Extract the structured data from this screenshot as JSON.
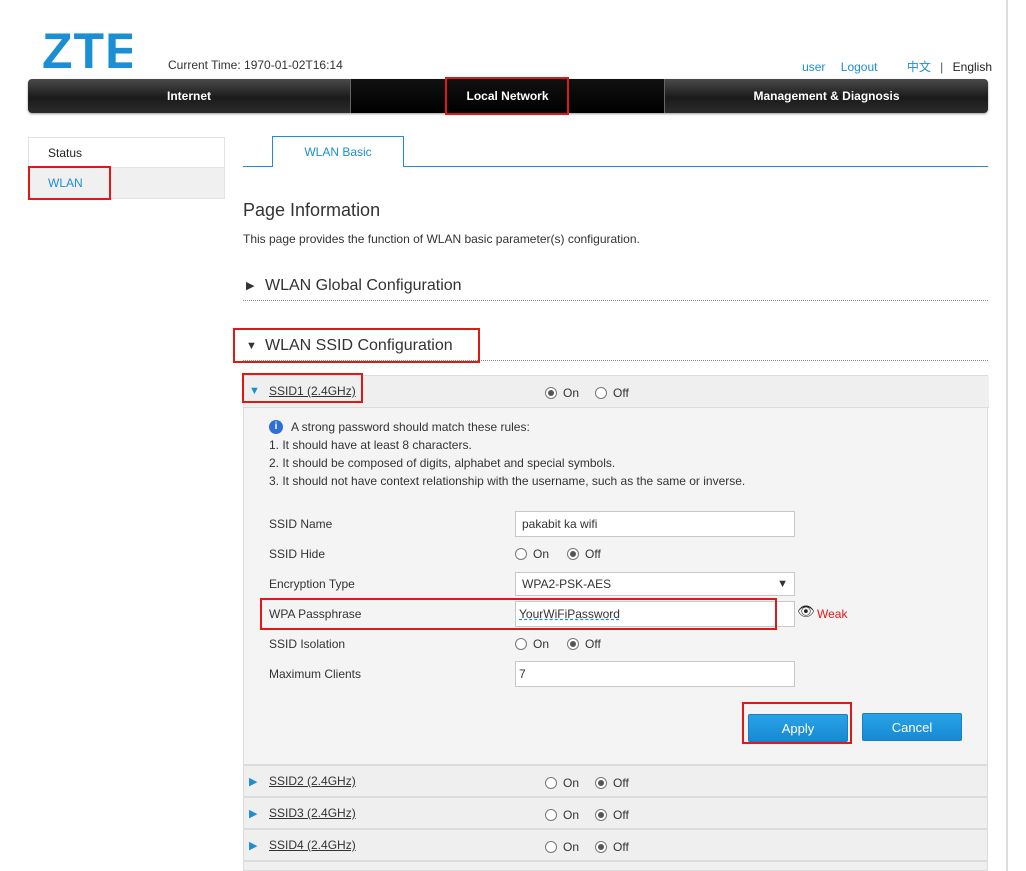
{
  "header": {
    "logo_text": "ZTE",
    "current_time_label": "Current Time: 1970-01-02T16:14",
    "user_link": "user",
    "logout_link": "Logout",
    "lang_zh": "中文",
    "lang_sep": "|",
    "lang_en": "English"
  },
  "nav": {
    "items": [
      {
        "label": "Internet"
      },
      {
        "label": "Local Network"
      },
      {
        "label": "Management & Diagnosis"
      }
    ]
  },
  "sidebar": {
    "items": [
      {
        "label": "Status"
      },
      {
        "label": "WLAN"
      }
    ]
  },
  "tabs": [
    {
      "label": "WLAN Basic"
    }
  ],
  "page": {
    "title": "Page Information",
    "description": "This page provides the function of WLAN basic parameter(s) configuration."
  },
  "sections": {
    "global": {
      "icon": "▶",
      "title": "WLAN Global Configuration"
    },
    "ssid": {
      "icon": "▼",
      "title": "WLAN SSID Configuration"
    }
  },
  "radio_labels": {
    "on": "On",
    "off": "Off"
  },
  "ssid1": {
    "name": "SSID1 (2.4GHz)",
    "state": "On",
    "rules": {
      "info_glyph": "i",
      "intro": "A strong password should match these rules:",
      "r1": "1. It should have at least 8 characters.",
      "r2": "2. It should be composed of digits, alphabet and special symbols.",
      "r3": "3. It should not have context relationship with the username, such as the same or inverse."
    },
    "fields": {
      "ssid_name_label": "SSID Name",
      "ssid_name_value": "pakabit ka wifi",
      "ssid_hide_label": "SSID Hide",
      "ssid_hide_value": "Off",
      "encryption_label": "Encryption Type",
      "encryption_value": "WPA2-PSK-AES",
      "wpa_label": "WPA Passphrase",
      "wpa_value": "YourWiFiPassword",
      "wpa_strength": "Weak",
      "isolation_label": "SSID Isolation",
      "isolation_value": "Off",
      "max_clients_label": "Maximum Clients",
      "max_clients_value": "7"
    },
    "apply_label": "Apply",
    "cancel_label": "Cancel"
  },
  "other_ssids": [
    {
      "name": "SSID2 (2.4GHz)",
      "state": "Off"
    },
    {
      "name": "SSID3 (2.4GHz)",
      "state": "Off"
    },
    {
      "name": "SSID4 (2.4GHz)",
      "state": "Off"
    }
  ],
  "colors": {
    "accent": "#1a8fd4",
    "highlight": "#e21818",
    "nav_dark": "#1a1a1a"
  }
}
